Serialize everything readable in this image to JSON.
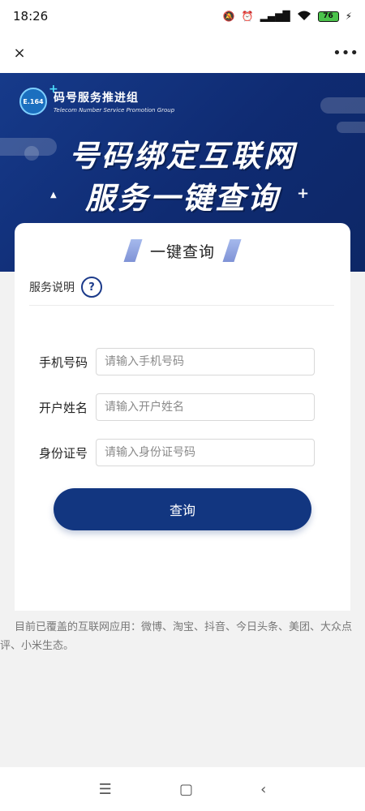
{
  "statusbar": {
    "time": "18:26",
    "signal_text": "4G",
    "battery_level": "76"
  },
  "nav": {
    "close_icon": "×",
    "more_icon": "•••"
  },
  "banner": {
    "logo_badge": "E.164",
    "logo_title": "码号服务推进组",
    "logo_subtitle": "Telecom Number Service  Promotion Group",
    "headline_line1": "号码绑定互联网",
    "headline_line2": "服务一键查询"
  },
  "card": {
    "title": "一键查询",
    "info_label": "服务说明",
    "help_icon": "?"
  },
  "form": {
    "fields": [
      {
        "label": "手机号码",
        "placeholder": "请输入手机号码"
      },
      {
        "label": "开户姓名",
        "placeholder": "请输入开户姓名"
      },
      {
        "label": "身份证号",
        "placeholder": "请输入身份证号码"
      }
    ],
    "submit_label": "查询"
  },
  "coverage": {
    "text": "目前已覆盖的互联网应用：微博、淘宝、抖音、今日头条、美团、大众点评、小米生态。"
  },
  "bottom_nav": {
    "menu_icon": "☰",
    "home_icon": "▢",
    "back_icon": "‹"
  }
}
